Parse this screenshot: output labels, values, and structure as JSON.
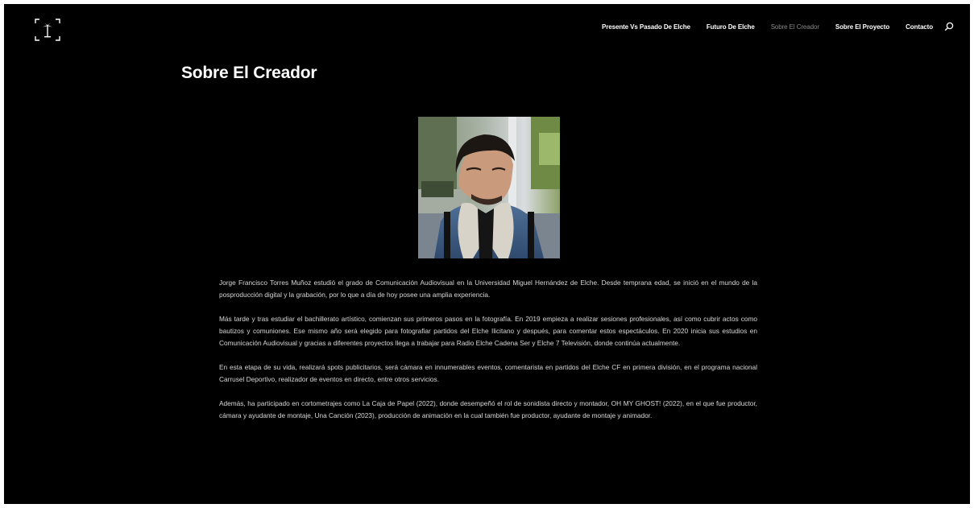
{
  "header": {
    "logo_icon": "camera-frame-palm-logo",
    "nav": [
      {
        "label": "Presente Vs Pasado De Elche",
        "active": false
      },
      {
        "label": "Futuro De Elche",
        "active": false
      },
      {
        "label": "Sobre El Creador",
        "active": true
      },
      {
        "label": "Sobre El Proyecto",
        "active": false
      },
      {
        "label": "Contacto",
        "active": false
      }
    ],
    "search_icon": "search-icon"
  },
  "main": {
    "title": "Sobre El Creador",
    "photo_icon": "creator-portrait-photo",
    "paragraphs": [
      "Jorge Francisco Torres Muñoz estudió el grado de Comunicación Audiovisual en la Universidad Miguel Hernández de Elche. Desde temprana edad, se inició en el mundo de la posproducción digital y la grabación, por lo que a día de hoy  posee una amplia experiencia.",
      "Más tarde y tras estudiar el bachillerato artístico, comienzan sus primeros pasos en la fotografía. En 2019 empieza a realizar sesiones profesionales, así como cubrir actos como bautizos y comuniones. Ese mismo año será elegido para fotografiar partidos del Elche Ilicitano y después, para comentar estos espectáculos. En 2020 inicia sus estudios en Comunicación Audiovisual y gracias a diferentes proyectos llega a trabajar para Radio Elche Cadena Ser y Elche 7 Televisión, donde continúa actualmente.",
      "En esta etapa de su vida, realizará spots publicitarios, será cámara en innumerables eventos, comentarista en partidos del Elche CF en primera división, en el programa nacional Carrusel Deportivo, realizador de eventos en directo, entre otros servicios.",
      "Además, ha participado en cortometrajes como La Caja de Papel (2022), donde desempeñó el rol de sonidista directo y montador, OH MY GHOST! (2022), en el que fue productor, cámara y ayudante de montaje, Una Canción (2023), producción de animación en la cual también fue productor, ayudante de montaje y animador."
    ]
  }
}
